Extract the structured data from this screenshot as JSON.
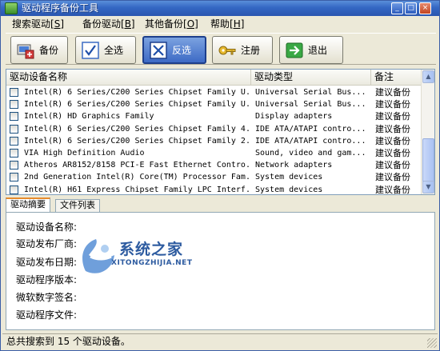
{
  "window": {
    "title": "驱动程序备份工具",
    "controls": {
      "minimize": "_",
      "maximize": "□",
      "close": "×"
    }
  },
  "menu": [
    {
      "label": "搜索驱动",
      "accel": "[S]"
    },
    {
      "label": "备份驱动",
      "accel": "[B]"
    },
    {
      "label": "其他备份",
      "accel": "[O]"
    },
    {
      "label": "帮助",
      "accel": "[H]"
    }
  ],
  "toolbar": {
    "backup": {
      "label": "备份",
      "icon": "backup-icon"
    },
    "select_all": {
      "label": "全选",
      "icon": "checkmark-icon"
    },
    "invert": {
      "label": "反选",
      "icon": "invert-selection-icon",
      "active": true
    },
    "register": {
      "label": "注册",
      "icon": "key-icon"
    },
    "exit": {
      "label": "退出",
      "icon": "exit-arrow-icon"
    }
  },
  "table": {
    "headers": {
      "name": "驱动设备名称",
      "type": "驱动类型",
      "note": "备注"
    },
    "rows": [
      {
        "name": "Intel(R) 6 Series/C200 Series Chipset Family U...",
        "type": "Universal Serial Bus...",
        "note": "建议备份",
        "checked": false
      },
      {
        "name": "Intel(R) 6 Series/C200 Series Chipset Family U...",
        "type": "Universal Serial Bus...",
        "note": "建议备份",
        "checked": false
      },
      {
        "name": "Intel(R) HD Graphics Family",
        "type": "Display adapters",
        "note": "建议备份",
        "checked": false
      },
      {
        "name": "Intel(R) 6 Series/C200 Series Chipset Family 4...",
        "type": "IDE ATA/ATAPI contro...",
        "note": "建议备份",
        "checked": false
      },
      {
        "name": "Intel(R) 6 Series/C200 Series Chipset Family 2...",
        "type": "IDE ATA/ATAPI contro...",
        "note": "建议备份",
        "checked": false
      },
      {
        "name": "VIA High Definition Audio",
        "type": "Sound, video and gam...",
        "note": "建议备份",
        "checked": false
      },
      {
        "name": "Atheros AR8152/8158 PCI-E Fast Ethernet Contro...",
        "type": "Network adapters",
        "note": "建议备份",
        "checked": false
      },
      {
        "name": "2nd Generation Intel(R) Core(TM) Processor Fam...",
        "type": "System devices",
        "note": "建议备份",
        "checked": false
      },
      {
        "name": "Intel(R) H61 Express Chipset Family LPC Interf...",
        "type": "System devices",
        "note": "建议备份",
        "checked": false
      }
    ]
  },
  "tabs": [
    {
      "label": "驱动摘要",
      "active": true
    },
    {
      "label": "文件列表",
      "active": false
    }
  ],
  "details": {
    "device_name": "驱动设备名称:",
    "vendor": "驱动发布厂商:",
    "date": "驱动发布日期:",
    "version": "驱动程序版本:",
    "signature": "微软数字签名:",
    "files": "驱动程序文件:"
  },
  "watermark": {
    "cn": "系统之家",
    "en": "XITONGZHIJIA.NET"
  },
  "status": {
    "text": "总共搜索到 15 个驱动设备。"
  },
  "colors": {
    "titlebar": "#3467c3",
    "accent_tab": "#e68b2c",
    "active_button": "#3d6ac5"
  }
}
